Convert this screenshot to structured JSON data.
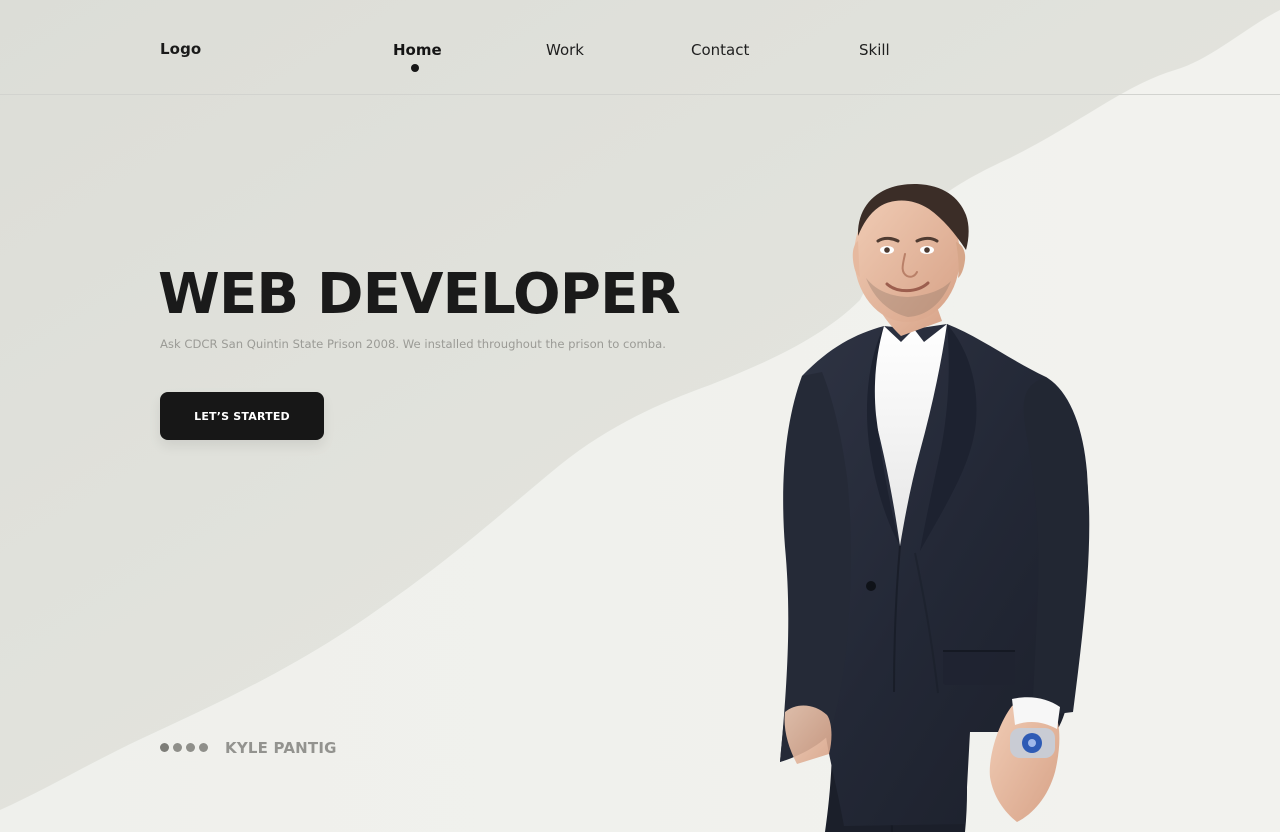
{
  "nav": {
    "logo": "Logo",
    "items": [
      {
        "label": "Home",
        "active": true
      },
      {
        "label": "Work",
        "active": false
      },
      {
        "label": "Contact",
        "active": false
      },
      {
        "label": "Skill",
        "active": false
      }
    ]
  },
  "hero": {
    "title": "WEB DEVELOPER",
    "subtitle": "Ask CDCR San Quintin State Prison 2008. We installed throughout the prison to comba.",
    "cta_label": "LET’S STARTED"
  },
  "footer": {
    "name": "KYLE PANTIG",
    "slider_dots": 4
  },
  "colors": {
    "background": "#f0f0ec",
    "accent": "#171717",
    "muted_text": "#9b9b96",
    "nav_border": "#d2d3cf"
  },
  "icons": {
    "active_indicator": "dot",
    "slider": "dots"
  }
}
